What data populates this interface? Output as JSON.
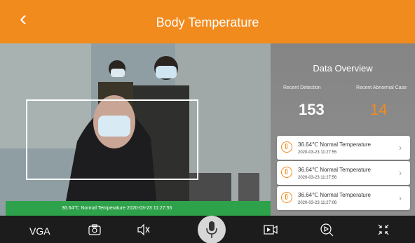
{
  "header": {
    "title": "Body Temperature"
  },
  "video": {
    "status": "36.64℃ Normal Temperature 2020-03-23 11:27:55"
  },
  "overview": {
    "title": "Data Overview",
    "recent_detection_label": "Recent Detection",
    "recent_abnormal_label": "Recent Abnormal Case",
    "recent_detection_count": "153",
    "recent_abnormal_count": "14",
    "records": [
      {
        "text": "36.64℃ Normal Temperature",
        "time": "2020-03-23 11:27:55"
      },
      {
        "text": "36.64℃ Normal Temperature",
        "time": "2020-03-23 11:27:56"
      },
      {
        "text": "36.64℃ Normal Temperature",
        "time": "2020-03-23 11:27:06"
      }
    ]
  },
  "toolbar": {
    "vga_label": "VGA"
  },
  "colors": {
    "accent": "#f28b1e",
    "status_green": "#2ea24a",
    "toolbar_bg": "#1c1c1c"
  },
  "icons": [
    "back-icon",
    "camera-icon",
    "mute-icon",
    "microphone-icon",
    "record-video-icon",
    "playback-search-icon",
    "shrink-icon",
    "thermometer-icon",
    "chevron-right-icon"
  ]
}
